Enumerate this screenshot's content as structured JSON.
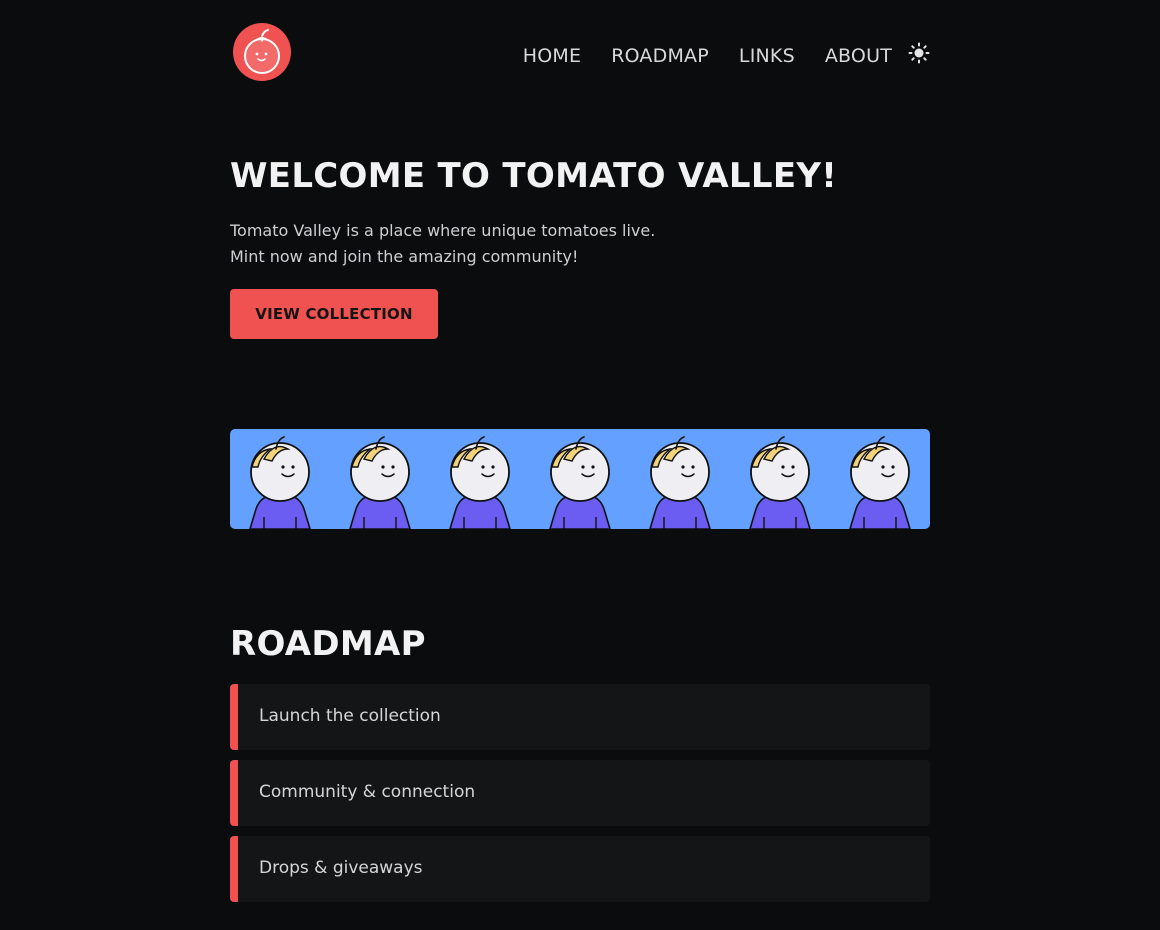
{
  "brand": {
    "logo_icon": "tomato-logo-icon",
    "accent_color": "#f05252"
  },
  "nav": {
    "items": [
      {
        "label": "HOME"
      },
      {
        "label": "ROADMAP"
      },
      {
        "label": "LINKS"
      },
      {
        "label": "ABOUT"
      }
    ],
    "theme_toggle_icon": "sun-icon"
  },
  "hero": {
    "title": "WELCOME TO TOMATO VALLEY!",
    "line1": "Tomato Valley is a place where unique tomatoes live.",
    "line2": "Mint now and join the amazing community!",
    "cta_label": "VIEW COLLECTION"
  },
  "banner": {
    "background_color": "#63a0ff",
    "character_count": 7,
    "hoodie_color": "#6b5cf2"
  },
  "roadmap": {
    "title": "ROADMAP",
    "items": [
      {
        "label": "Launch the collection"
      },
      {
        "label": "Community & connection"
      },
      {
        "label": "Drops & giveaways"
      }
    ]
  }
}
